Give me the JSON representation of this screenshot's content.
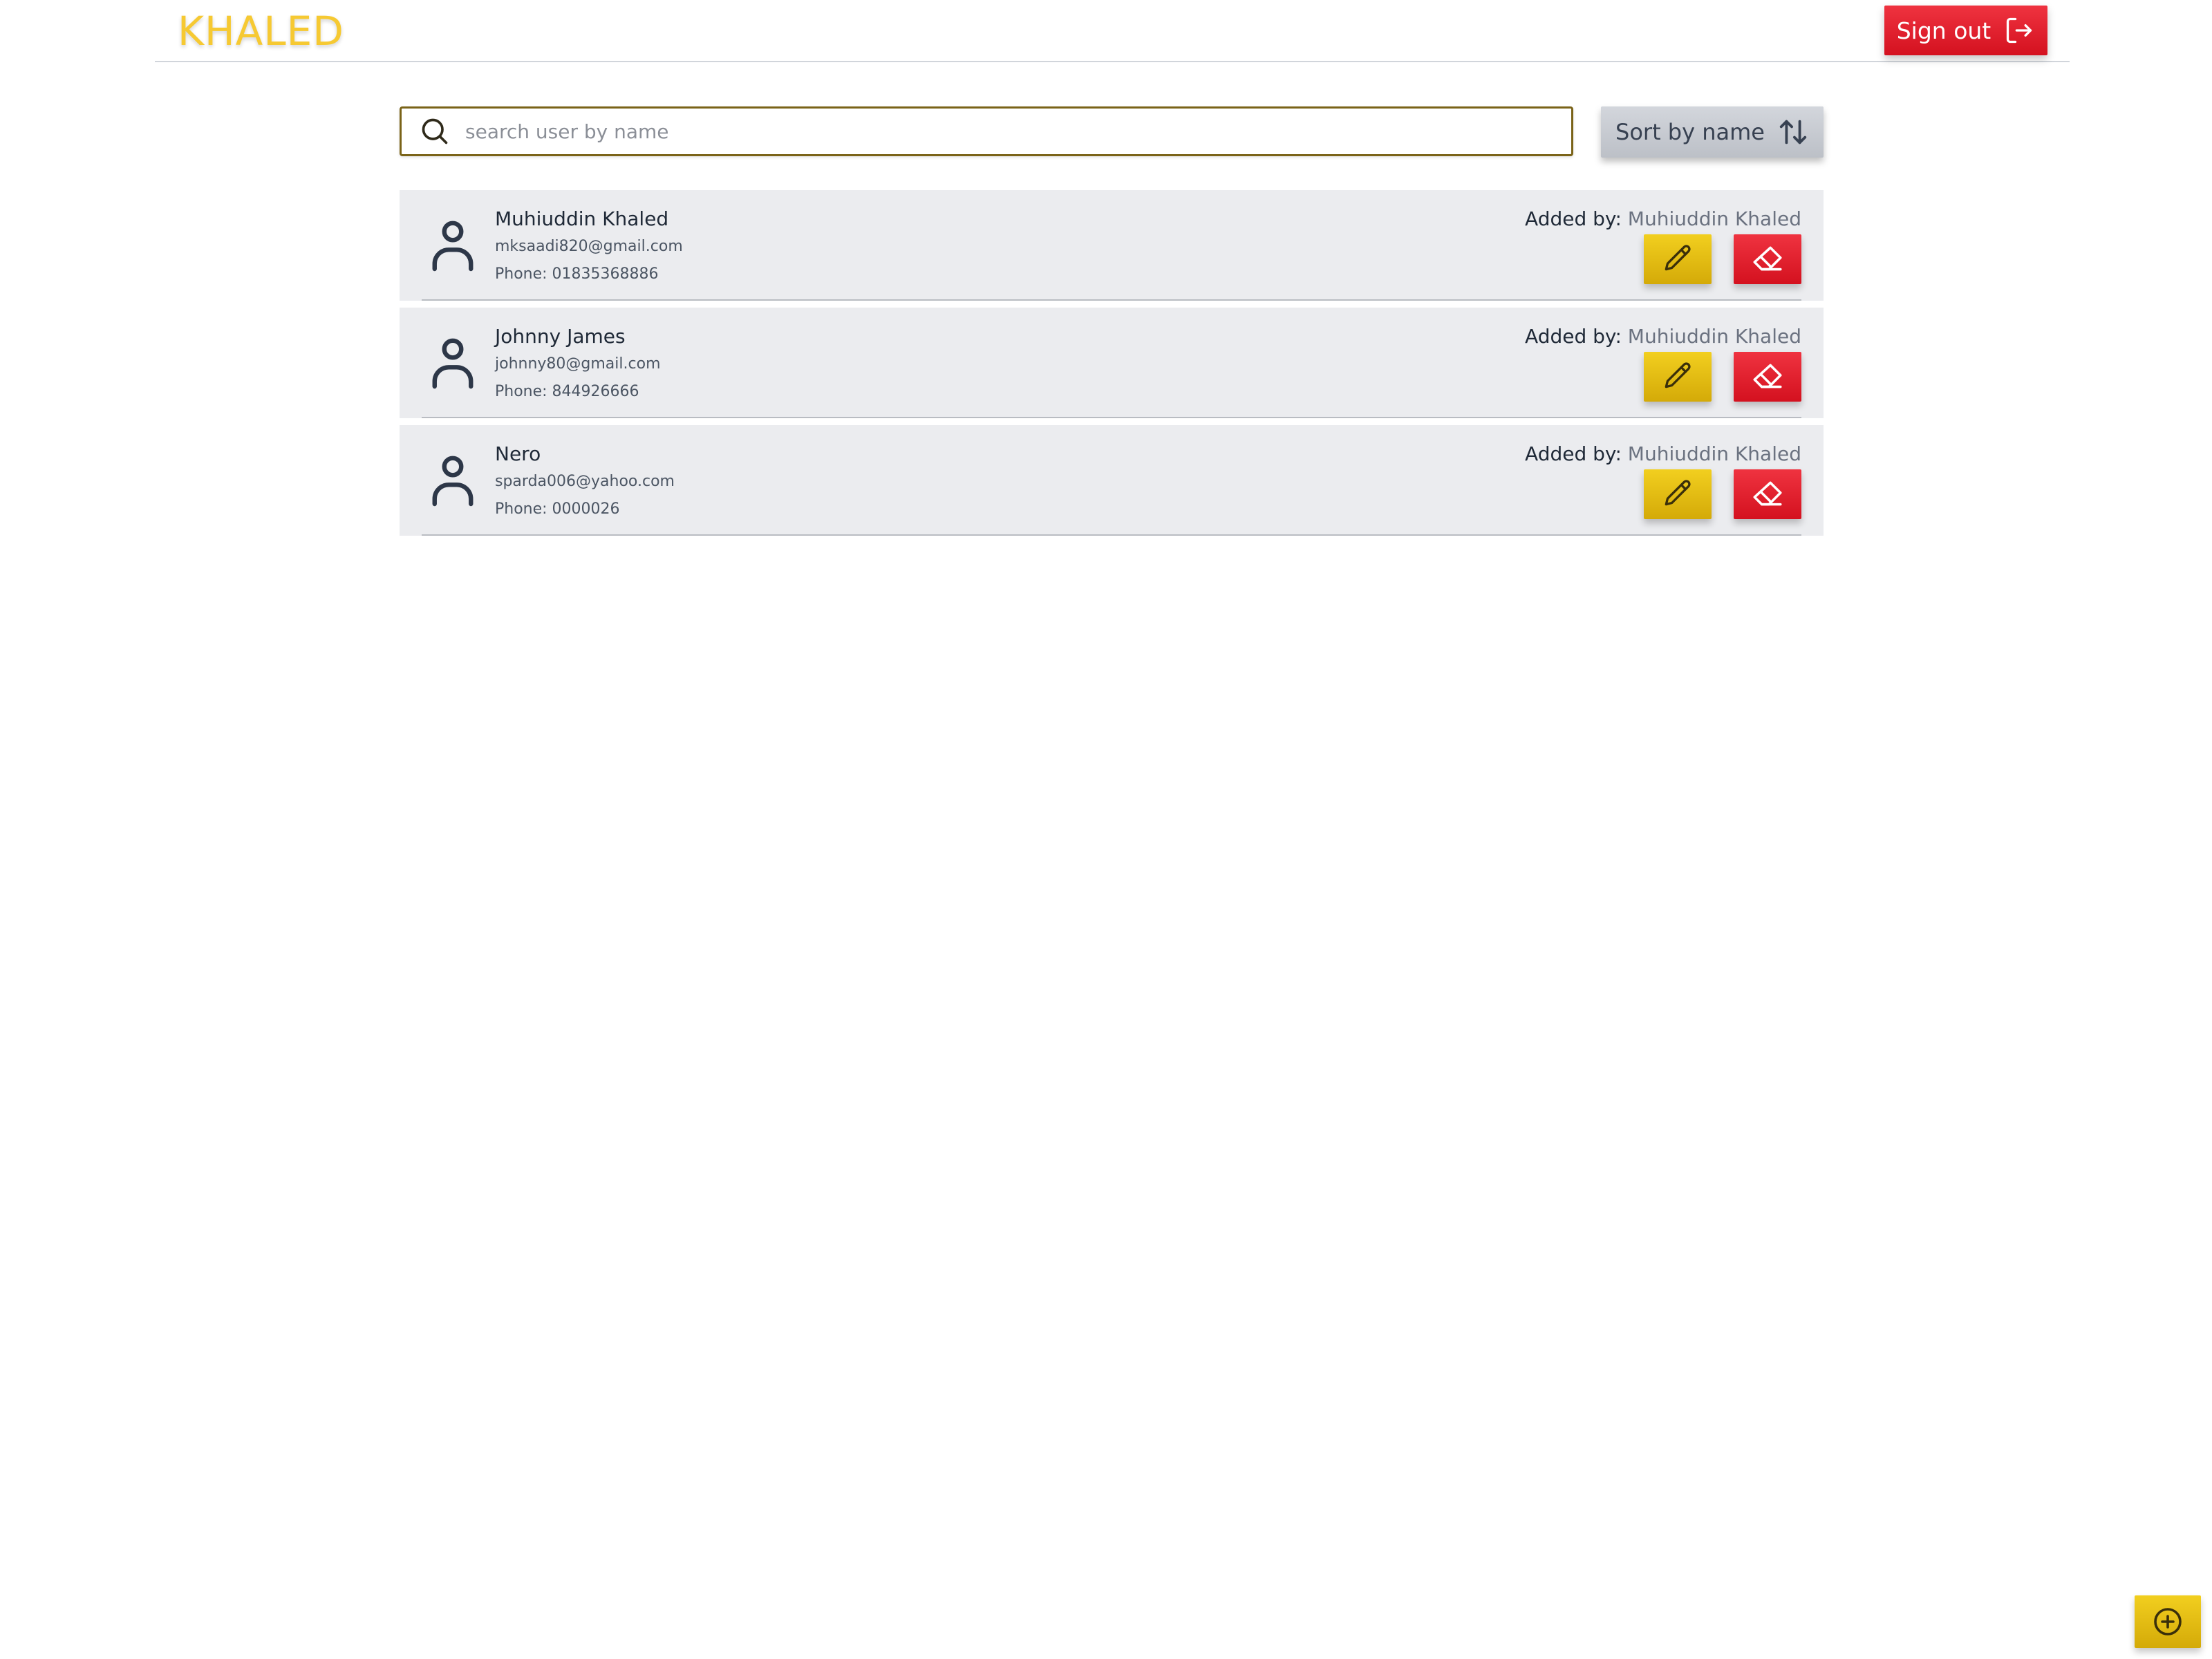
{
  "header": {
    "brand": "KHALED",
    "signout_label": "Sign out",
    "signout_icon": "sign-out-icon"
  },
  "search": {
    "placeholder": "search user by name",
    "value": "",
    "icon": "search-icon"
  },
  "sort": {
    "label": "Sort by name",
    "icon": "sort-arrows-icon"
  },
  "users": [
    {
      "name": "Muhiuddin Khaled",
      "email": "mksaadi820@gmail.com",
      "phone": "Phone: 01835368886",
      "added_by_label": "Added by:",
      "added_by": "Muhiuddin Khaled"
    },
    {
      "name": "Johnny James",
      "email": "johnny80@gmail.com",
      "phone": "Phone: 844926666",
      "added_by_label": "Added by:",
      "added_by": "Muhiuddin Khaled"
    },
    {
      "name": "Nero",
      "email": "sparda006@yahoo.com",
      "phone": "Phone: 0000026",
      "added_by_label": "Added by:",
      "added_by": "Muhiuddin Khaled"
    }
  ],
  "icons": {
    "avatar": "user-icon",
    "edit": "pencil-icon",
    "delete": "eraser-icon",
    "add": "plus-circle-icon"
  },
  "colors": {
    "brand": "#f6c932",
    "danger": "#e0202c",
    "warning": "#e6be12",
    "neutral": "#c6c9cf",
    "row_bg": "#ebecef"
  }
}
